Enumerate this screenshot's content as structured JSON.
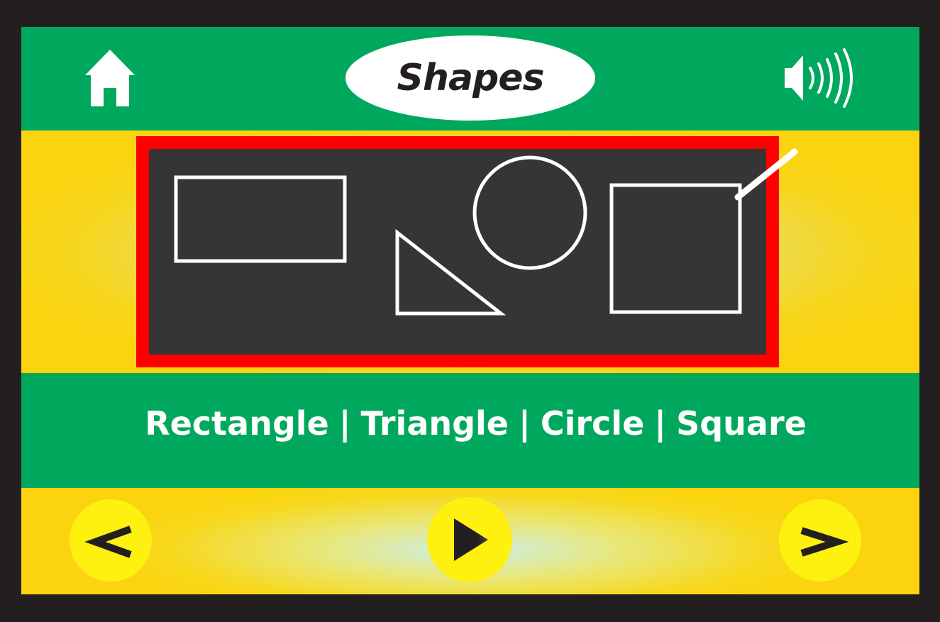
{
  "header": {
    "title": "Shapes",
    "home_icon": "home-icon",
    "sound_icon": "speaker-icon"
  },
  "board": {
    "frame_color": "#ff0000",
    "board_color": "#363435",
    "chalk_color": "#ffffff",
    "shapes": [
      "rectangle",
      "triangle",
      "circle",
      "square"
    ]
  },
  "labels": {
    "items": [
      "Rectangle",
      "Triangle",
      "Circle",
      "Square"
    ],
    "separator": "|"
  },
  "nav": {
    "prev_label": "<",
    "next_label": ">",
    "play_icon": "play-icon"
  },
  "colors": {
    "green": "#00a85d",
    "yellow": "#fbd40f",
    "button_yellow": "#fff10f",
    "dark": "#231f20"
  }
}
